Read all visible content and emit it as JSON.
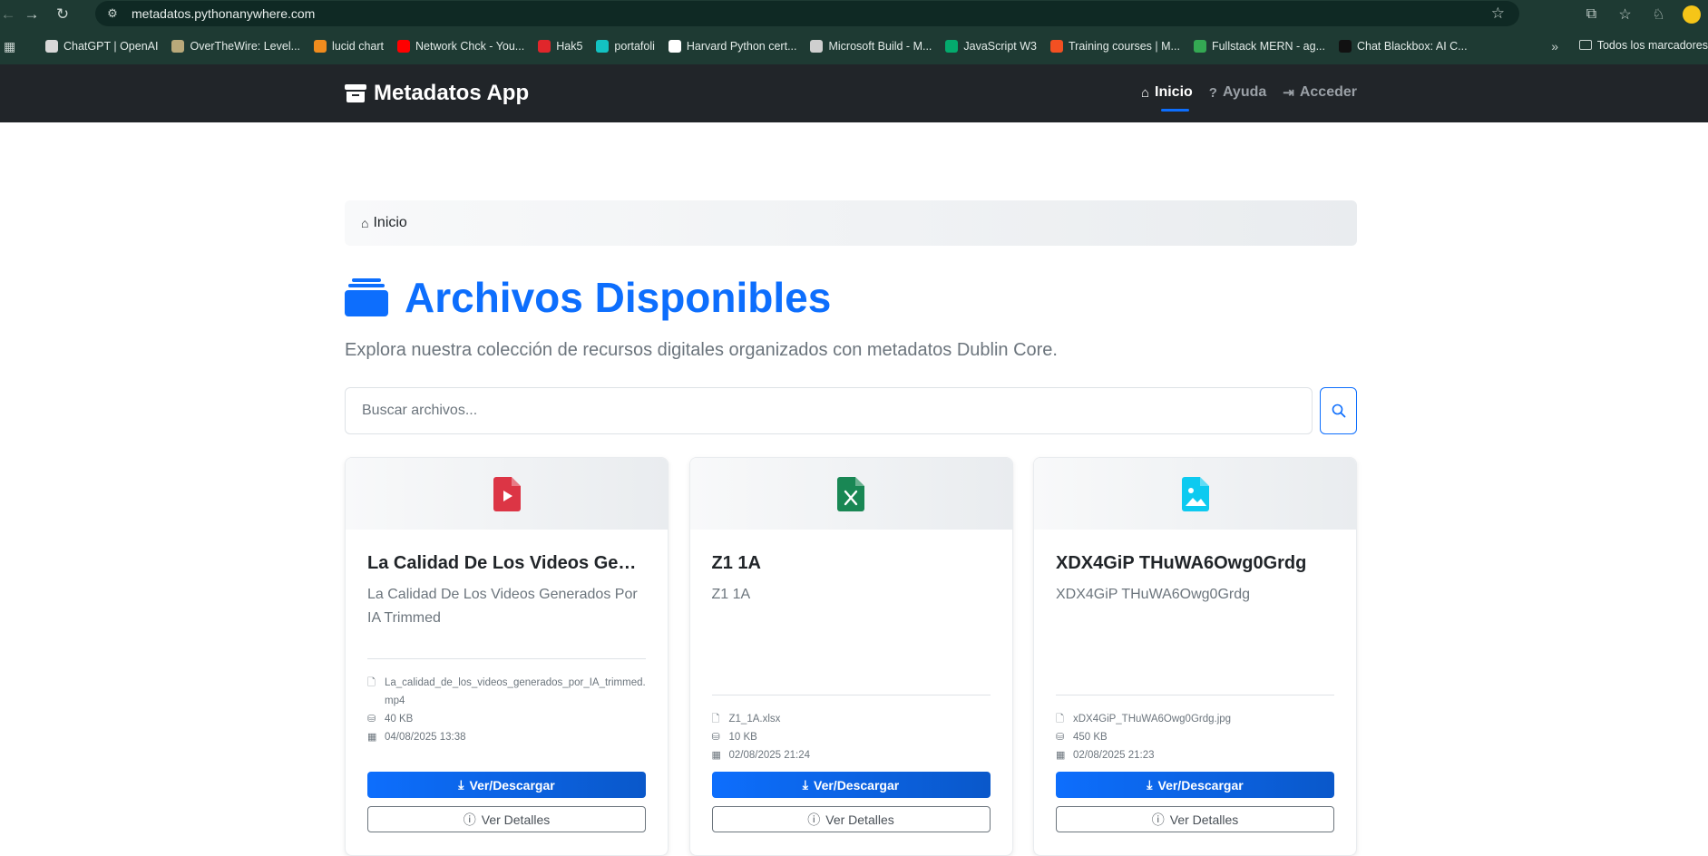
{
  "browser": {
    "url": "metadatos.pythonanywhere.com",
    "bookmarks": [
      {
        "label": "ChatGPT | OpenAI",
        "color": "#d8d8d8"
      },
      {
        "label": "OverTheWire: Level...",
        "color": "#b9a97a"
      },
      {
        "label": "lucid chart",
        "color": "#f08c1e"
      },
      {
        "label": "Network Chck - You...",
        "color": "#ff0000"
      },
      {
        "label": "Hak5",
        "color": "#e0262b"
      },
      {
        "label": "portafoli",
        "color": "#13c2c2"
      },
      {
        "label": "Harvard Python cert...",
        "color": "#ffffff"
      },
      {
        "label": "Microsoft Build - M...",
        "color": "#cfcfcf"
      },
      {
        "label": "JavaScript W3",
        "color": "#04aa6d"
      },
      {
        "label": "Training courses | M...",
        "color": "#f25022"
      },
      {
        "label": "Fullstack MERN - ag...",
        "color": "#34a853"
      },
      {
        "label": "Chat Blackbox: AI C...",
        "color": "#111111"
      }
    ],
    "all_bookmarks": "Todos los marcadores"
  },
  "navbar": {
    "brand": "Metadatos App",
    "links": [
      {
        "label": "Inicio",
        "icon": "home-icon",
        "active": true
      },
      {
        "label": "Ayuda",
        "icon": "question-circle-icon",
        "active": false
      },
      {
        "label": "Acceder",
        "icon": "login-icon",
        "active": false
      }
    ]
  },
  "breadcrumb": {
    "label": "Inicio"
  },
  "page": {
    "title": "Archivos Disponibles",
    "lead": "Explora nuestra colección de recursos digitales organizados con metadatos Dublin Core."
  },
  "search": {
    "placeholder": "Buscar archivos..."
  },
  "cards": [
    {
      "title": "La Calidad De Los Videos Gene...",
      "description": "La Calidad De Los Videos Generados Por IA Trimmed",
      "filename": "La_calidad_de_los_videos_generados_por_IA_trimmed.mp4",
      "size": "40 KB",
      "date": "04/08/2025 13:38",
      "icon": "file-video-icon",
      "icon_color": "#dc3545",
      "download_label": "Ver/Descargar",
      "details_label": "Ver Detalles"
    },
    {
      "title": "Z1 1A",
      "description": "Z1 1A",
      "filename": "Z1_1A.xlsx",
      "size": "10 KB",
      "date": "02/08/2025 21:24",
      "icon": "file-excel-icon",
      "icon_color": "#198754",
      "download_label": "Ver/Descargar",
      "details_label": "Ver Detalles"
    },
    {
      "title": "XDX4GiP THuWA6Owg0Grdg",
      "description": "XDX4GiP THuWA6Owg0Grdg",
      "filename": "xDX4GiP_THuWA6Owg0Grdg.jpg",
      "size": "450 KB",
      "date": "02/08/2025 21:23",
      "icon": "file-image-icon",
      "icon_color": "#0dcaf0",
      "download_label": "Ver/Descargar",
      "details_label": "Ver Detalles"
    }
  ]
}
